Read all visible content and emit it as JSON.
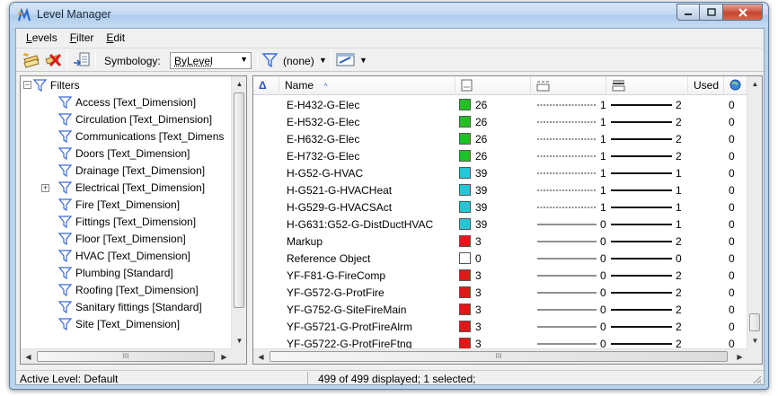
{
  "window": {
    "title": "Level Manager"
  },
  "menu": [
    {
      "underline": "L",
      "rest": "evels"
    },
    {
      "underline": "F",
      "rest": "ilter"
    },
    {
      "underline": "E",
      "rest": "dit"
    }
  ],
  "toolbar": {
    "symbology_label": "Symbology:",
    "symbology_value": "ByLevel",
    "filter_value": "(none)",
    "icons": [
      "new-level-icon",
      "delete-level-icon",
      "import-export-icon",
      "filter-icon",
      "edit-filter-icon"
    ]
  },
  "tree": {
    "root": "Filters",
    "items": [
      "Access [Text_Dimension]",
      "Circulation [Text_Dimension]",
      "Communications [Text_Dimens",
      "Doors [Text_Dimension]",
      "Drainage [Text_Dimension]",
      "Electrical [Text_Dimension]",
      "Fire [Text_Dimension]",
      "Fittings [Text_Dimension]",
      "Floor [Text_Dimension]",
      "HVAC [Text_Dimension]",
      "Plumbing [Standard]",
      "Roofing [Text_Dimension]",
      "Sanitary fittings [Standard]",
      "Site [Text_Dimension]"
    ],
    "hscroll_glyph": "III"
  },
  "table": {
    "sort_glyph": "Δ",
    "headers": {
      "name": "Name",
      "used": "Used"
    },
    "header_icons": [
      "color-column-icon",
      "style-column-icon",
      "weight-column-icon",
      "globe-icon"
    ],
    "rows": [
      {
        "name": "E-H432-G-Elec",
        "swatch": "#22c022",
        "color": "26",
        "style": "1",
        "style_dashed": true,
        "weight": "2",
        "used": "0"
      },
      {
        "name": "E-H532-G-Elec",
        "swatch": "#22c022",
        "color": "26",
        "style": "1",
        "style_dashed": true,
        "weight": "2",
        "used": "0"
      },
      {
        "name": "E-H632-G-Elec",
        "swatch": "#22c022",
        "color": "26",
        "style": "1",
        "style_dashed": true,
        "weight": "2",
        "used": "0"
      },
      {
        "name": "E-H732-G-Elec",
        "swatch": "#22c022",
        "color": "26",
        "style": "1",
        "style_dashed": true,
        "weight": "2",
        "used": "0"
      },
      {
        "name": "H-G52-G-HVAC",
        "swatch": "#27c6d6",
        "color": "39",
        "style": "1",
        "style_dashed": true,
        "weight": "1",
        "used": "0"
      },
      {
        "name": "H-G521-G-HVACHeat",
        "swatch": "#27c6d6",
        "color": "39",
        "style": "1",
        "style_dashed": true,
        "weight": "1",
        "used": "0"
      },
      {
        "name": "H-G529-G-HVACSAct",
        "swatch": "#27c6d6",
        "color": "39",
        "style": "1",
        "style_dashed": true,
        "weight": "1",
        "used": "0"
      },
      {
        "name": "H-G631:G52-G-DistDuctHVAC",
        "swatch": "#27c6d6",
        "color": "39",
        "style": "0",
        "style_dashed": false,
        "weight": "1",
        "used": "0"
      },
      {
        "name": "Markup",
        "swatch": "#e01818",
        "color": "3",
        "style": "0",
        "style_dashed": false,
        "weight": "2",
        "used": "0"
      },
      {
        "name": "Reference Object",
        "swatch": "#ffffff",
        "color": "0",
        "style": "0",
        "style_dashed": false,
        "weight": "0",
        "used": "0"
      },
      {
        "name": "YF-F81-G-FireComp",
        "swatch": "#e01818",
        "color": "3",
        "style": "0",
        "style_dashed": false,
        "weight": "2",
        "used": "0"
      },
      {
        "name": "YF-G572-G-ProtFire",
        "swatch": "#e01818",
        "color": "3",
        "style": "0",
        "style_dashed": false,
        "weight": "2",
        "used": "0"
      },
      {
        "name": "YF-G752-G-SiteFireMain",
        "swatch": "#e01818",
        "color": "3",
        "style": "0",
        "style_dashed": false,
        "weight": "2",
        "used": "0"
      },
      {
        "name": "YF-G5721-G-ProtFireAlrm",
        "swatch": "#e01818",
        "color": "3",
        "style": "0",
        "style_dashed": false,
        "weight": "2",
        "used": "0"
      },
      {
        "name": "YF-G5722-G-ProtFireFtng",
        "swatch": "#e01818",
        "color": "3",
        "style": "0",
        "style_dashed": false,
        "weight": "2",
        "used": "0"
      }
    ],
    "hscroll_glyph": "III"
  },
  "status": {
    "active_level": "Active Level: Default",
    "summary": "499 of 499 displayed; 1 selected;"
  }
}
